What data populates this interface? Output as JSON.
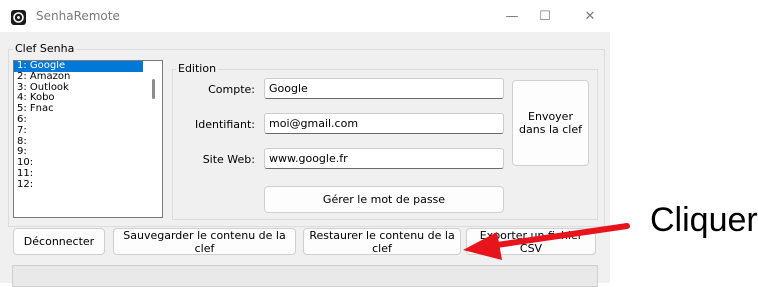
{
  "window": {
    "title": "SenhaRemote",
    "controls": [
      "—",
      "☐",
      "✕"
    ]
  },
  "clef_group": {
    "label": "Clef Senha"
  },
  "list": {
    "items": [
      "1: Google",
      "2: Amazon",
      "3: Outlook",
      "4: Kobo",
      "5: Fnac",
      "6:",
      "7:",
      "8:",
      "9:",
      "10:",
      "11:",
      "12:"
    ],
    "selected_index": 0
  },
  "edition": {
    "label": "Edition",
    "compte_label": "Compte:",
    "compte_value": "Google",
    "identifiant_label": "Identifiant:",
    "identifiant_value": "moi@gmail.com",
    "site_label": "Site Web:",
    "site_value": "www.google.fr",
    "envoyer_label": "Envoyer\ndans la clef",
    "gerer_label": "Gérer le mot de passe"
  },
  "bottom": {
    "deconnecter": "Déconnecter",
    "sauvegarder": "Sauvegarder le contenu de la clef",
    "restaurer": "Restaurer le contenu de la clef",
    "exporter": "Exporter un fichier CSV"
  },
  "annotation": {
    "text": "Cliquer",
    "arrow_color": "#e8141b"
  }
}
